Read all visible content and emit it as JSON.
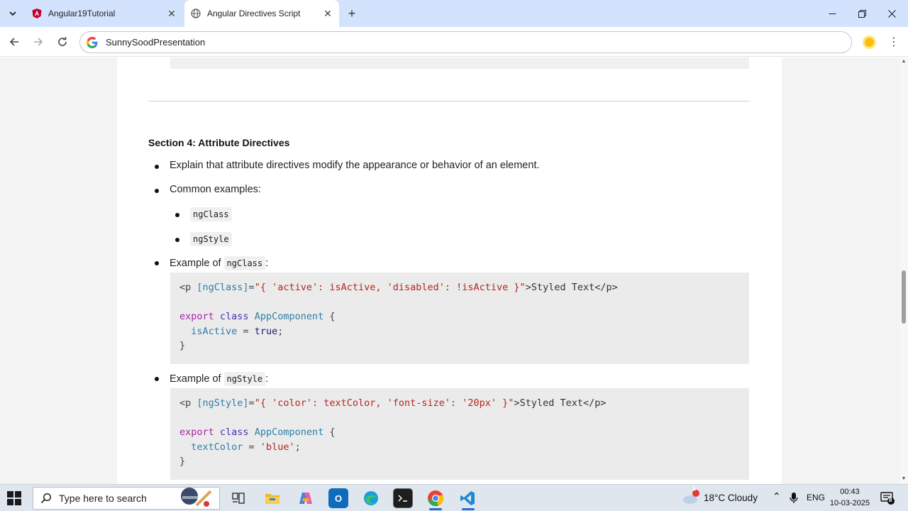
{
  "browser": {
    "tabs": [
      {
        "title": "Angular19Tutorial",
        "active": false,
        "icon": "angular-icon"
      },
      {
        "title": "Angular Directives Script",
        "active": true,
        "icon": "globe-icon"
      }
    ],
    "omnibox_text": "SunnySoodPresentation"
  },
  "page": {
    "section_title": "Section 4: Attribute Directives",
    "bullets": {
      "explain": "Explain that attribute directives modify the appearance or behavior of an element.",
      "common_examples": "Common examples:",
      "sub_items": [
        "ngClass",
        "ngStyle"
      ],
      "example_prefix": "Example of",
      "example_suffix": ":",
      "example1_code_name": "ngClass",
      "example2_code_name": "ngStyle"
    },
    "code1": {
      "line1": [
        "<p ",
        "[ngClass]",
        "=",
        "\"{ 'active': isActive, 'disabled': !isActive }\"",
        ">Styled Text</p>"
      ],
      "line3": [
        "export",
        " ",
        "class",
        " ",
        "AppComponent",
        " {"
      ],
      "line4": [
        "  ",
        "isActive",
        " = ",
        "true",
        ";"
      ],
      "line5": "}"
    },
    "code2": {
      "line1": [
        "<p ",
        "[ngStyle]",
        "=",
        "\"{ 'color': textColor, 'font-size': '20px' }\"",
        ">Styled Text</p>"
      ],
      "line3": [
        "export",
        " ",
        "class",
        " ",
        "AppComponent",
        " {"
      ],
      "line4": [
        "  ",
        "textColor",
        " = ",
        "'blue'",
        ";"
      ],
      "line5": "}"
    }
  },
  "taskbar": {
    "search_placeholder": "Type here to search",
    "weather": "18°C  Cloudy",
    "weather_badge": "1",
    "language": "ENG",
    "time": "00:43",
    "date": "10-03-2025",
    "notification_count": "8"
  },
  "colors": {
    "tabstrip": "#d3e3fd",
    "taskbar": "#dfe6ee",
    "code_bg": "#ebebeb"
  }
}
